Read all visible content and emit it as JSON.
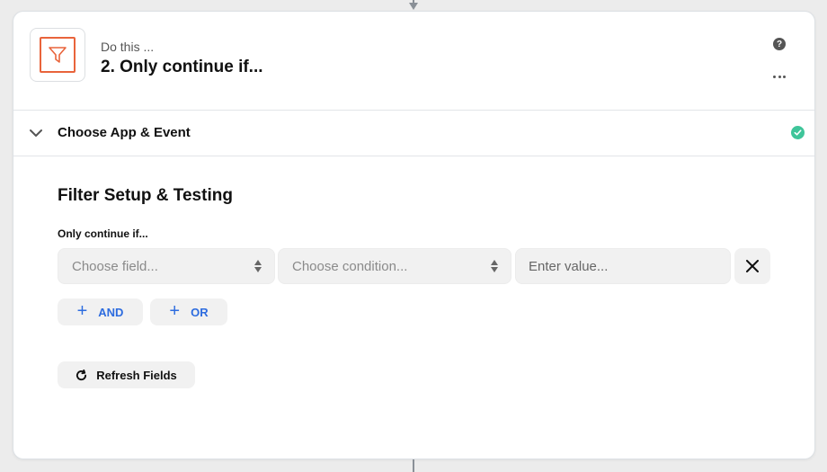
{
  "step": {
    "eyebrow": "Do this ...",
    "title": "2. Only continue if...",
    "icon": "filter-icon",
    "accent_color": "#e9643b"
  },
  "header_actions": {
    "help_icon": "question-circle-icon",
    "help_glyph": "?",
    "more_icon": "ellipsis-icon"
  },
  "section": {
    "label": "Choose App & Event",
    "status": "complete",
    "status_color": "#3fc59a"
  },
  "filter": {
    "title": "Filter Setup & Testing",
    "condition_label": "Only continue if...",
    "rule": {
      "field_placeholder": "Choose field...",
      "condition_placeholder": "Choose condition...",
      "value_placeholder": "Enter value..."
    },
    "and_label": "AND",
    "or_label": "OR",
    "plus_glyph": "+",
    "refresh_label": "Refresh Fields",
    "link_color": "#2d6cdf"
  }
}
